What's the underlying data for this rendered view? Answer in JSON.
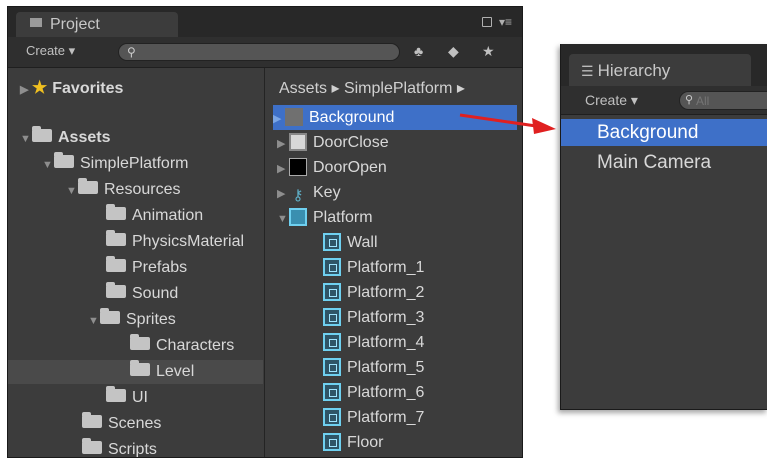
{
  "project": {
    "tab_label": "Project",
    "create_label": "Create",
    "search_placeholder": "",
    "tree": {
      "favorites": "Favorites",
      "assets": "Assets",
      "simple_platform": "SimplePlatform",
      "resources": "Resources",
      "animation": "Animation",
      "physics_material": "PhysicsMaterial",
      "prefabs": "Prefabs",
      "sound": "Sound",
      "sprites": "Sprites",
      "characters": "Characters",
      "level": "Level",
      "ui": "UI",
      "scenes": "Scenes",
      "scripts": "Scripts"
    },
    "breadcrumb": "Assets ▸ SimplePlatform ▸",
    "assets": [
      "Background",
      "DoorClose",
      "DoorOpen",
      "Key",
      "Platform",
      "Wall",
      "Platform_1",
      "Platform_2",
      "Platform_3",
      "Platform_4",
      "Platform_5",
      "Platform_6",
      "Platform_7",
      "Floor"
    ]
  },
  "hierarchy": {
    "tab_label": "Hierarchy",
    "create_label": "Create",
    "search_placeholder": "All",
    "items": [
      "Background",
      "Main Camera"
    ]
  },
  "colors": {
    "selection": "#3e70c8",
    "panel_bg": "#3c3c3c",
    "arrow": "#e02020"
  }
}
